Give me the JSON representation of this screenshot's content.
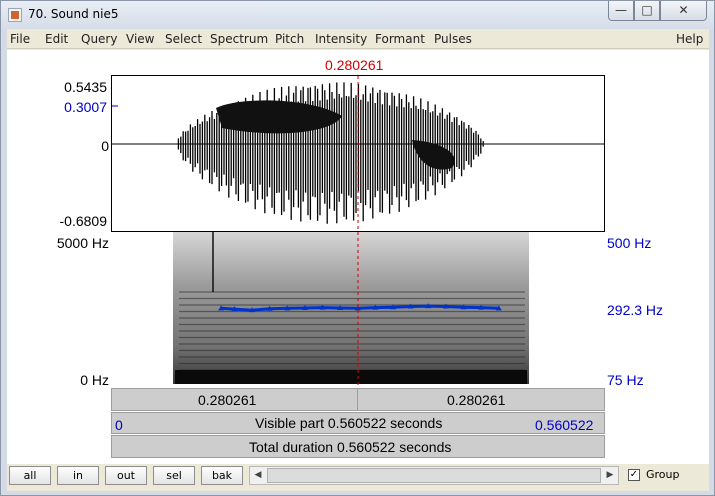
{
  "window": {
    "title": "70. Sound nie5",
    "minimize": "—",
    "maximize": "□",
    "close": "✕"
  },
  "menu": [
    "File",
    "Edit",
    "Query",
    "View",
    "Select",
    "Spectrum",
    "Pitch",
    "Intensity",
    "Formant",
    "Pulses",
    "Help"
  ],
  "cursor_time": "0.280261",
  "waveform": {
    "y_max": "0.5435",
    "y_cursor": "0.3007",
    "y_zero": "0",
    "y_min": "-0.6809"
  },
  "spectrogram": {
    "freq_max": "5000 Hz",
    "freq_min": "0 Hz",
    "pitch_max": "500 Hz",
    "pitch_cursor": "292.3 Hz",
    "pitch_min": "75 Hz"
  },
  "bars": {
    "left_time": "0.280261",
    "right_time": "0.280261",
    "visible_start": "0",
    "visible_text": "Visible part 0.560522 seconds",
    "visible_end": "0.560522",
    "total_text": "Total duration 0.560522 seconds"
  },
  "toolbar": {
    "buttons": [
      "all",
      "in",
      "out",
      "sel",
      "bak"
    ],
    "scroll_left": "◀",
    "scroll_right": "▶",
    "group_checked": "✓",
    "group_label": "Group"
  },
  "colors": {
    "cursor": "#d40000",
    "pitch": "#0033cc",
    "axis_blue": "#0000c8"
  },
  "chart_data": {
    "type": "line",
    "x": [
      0.125,
      0.14,
      0.16,
      0.18,
      0.2,
      0.22,
      0.24,
      0.26,
      0.28,
      0.3,
      0.32,
      0.34,
      0.36,
      0.38,
      0.4,
      0.42,
      0.44
    ],
    "series": [
      {
        "values": [
          292,
          290,
          287,
          291,
          292,
          293,
          294,
          293,
          292,
          294,
          295,
          297,
          298,
          297,
          295,
          294,
          292
        ]
      }
    ],
    "xlim": [
      0,
      0.560522
    ],
    "ylim": [
      75,
      500
    ]
  }
}
